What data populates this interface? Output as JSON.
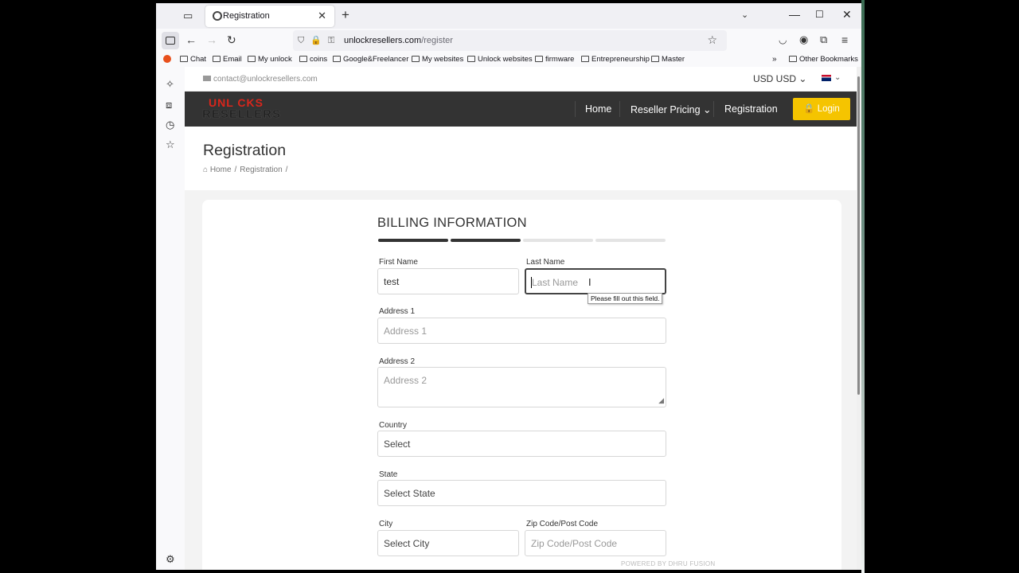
{
  "browser": {
    "tab_title": "Registration",
    "url_host": "unlockresellers.com",
    "url_path": "/register",
    "bookmarks": [
      "Chat",
      "Email",
      "My unlock",
      "coins",
      "Google&Freelancer",
      "My websites",
      "Unlock websites",
      "firmware",
      "Entrepreneurship",
      "Master"
    ],
    "other_bookmarks": "Other Bookmarks"
  },
  "site": {
    "contact_email": "contact@unlockresellers.com",
    "currency": "USD USD",
    "logo_line1": "UNL CKS",
    "logo_line2": "RESELLERS",
    "nav": {
      "home": "Home",
      "reseller_pricing": "Reseller Pricing",
      "registration": "Registration",
      "login": "Login"
    },
    "page_title": "Registration",
    "breadcrumb": {
      "home": "Home",
      "current": "Registration"
    },
    "powered_by": "POWERED BY DHRU FUSION"
  },
  "form": {
    "heading": "BILLING INFORMATION",
    "progress": {
      "steps_total": 4,
      "steps_complete": 2
    },
    "first_name": {
      "label": "First Name",
      "value": "test"
    },
    "last_name": {
      "label": "Last Name",
      "placeholder": "Last Name",
      "validation": "Please fill out this field."
    },
    "address1": {
      "label": "Address 1",
      "placeholder": "Address 1"
    },
    "address2": {
      "label": "Address 2",
      "placeholder": "Address 2"
    },
    "country": {
      "label": "Country",
      "value": "Select"
    },
    "state": {
      "label": "State",
      "value": "Select State"
    },
    "city": {
      "label": "City",
      "value": "Select City"
    },
    "zip": {
      "label": "Zip Code/Post Code",
      "placeholder": "Zip Code/Post Code"
    }
  },
  "colors": {
    "accent": "#f5c400",
    "nav_bg": "#333333",
    "logo_red": "#d9261c"
  }
}
